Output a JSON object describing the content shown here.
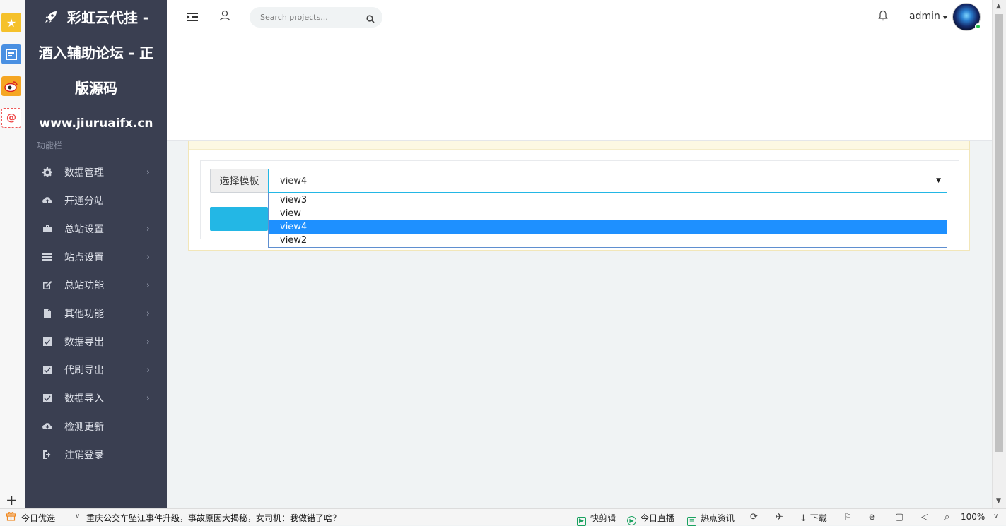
{
  "browser": {
    "status_today_label": "今日优选",
    "status_news": "重庆公交车坠江事件升级，事故原因大揭秘，女司机：我做错了啥？",
    "status_clip": "快剪辑",
    "status_live": "今日直播",
    "status_hot": "热点资讯",
    "status_download": "下载",
    "status_zoom": "100%"
  },
  "sidebar": {
    "brand_line1": "彩虹云代挂 -",
    "brand_line2": "酒入辅助论坛 - 正",
    "brand_line3": "版源码",
    "brand_url": "www.jiuruaifx.cn",
    "section_label": "功能栏",
    "items": [
      {
        "label": "数据管理",
        "icon": "gear-icon",
        "has_children": true
      },
      {
        "label": "开通分站",
        "icon": "cloud-upload-icon",
        "has_children": false
      },
      {
        "label": "总站设置",
        "icon": "briefcase-icon",
        "has_children": true
      },
      {
        "label": "站点设置",
        "icon": "list-icon",
        "has_children": true
      },
      {
        "label": "总站功能",
        "icon": "edit-icon",
        "has_children": true
      },
      {
        "label": "其他功能",
        "icon": "file-icon",
        "has_children": true
      },
      {
        "label": "数据导出",
        "icon": "checkbox-icon",
        "has_children": true
      },
      {
        "label": "代刷导出",
        "icon": "checkbox-icon",
        "has_children": true
      },
      {
        "label": "数据导入",
        "icon": "checkbox-icon",
        "has_children": true
      },
      {
        "label": "检测更新",
        "icon": "cloud-download-icon",
        "has_children": false
      },
      {
        "label": "注销登录",
        "icon": "logout-icon",
        "has_children": false
      }
    ]
  },
  "topbar": {
    "search_placeholder": "Search projects...",
    "username": "admin"
  },
  "form": {
    "template_label": "选择模板",
    "template_value": "view4",
    "template_options": [
      "view3",
      "view",
      "view4",
      "view2"
    ],
    "selected_index": 2
  },
  "colors": {
    "sidebar_bg": "#3a3f51",
    "accent": "#23b7e5",
    "option_highlight": "#1e90ff"
  }
}
